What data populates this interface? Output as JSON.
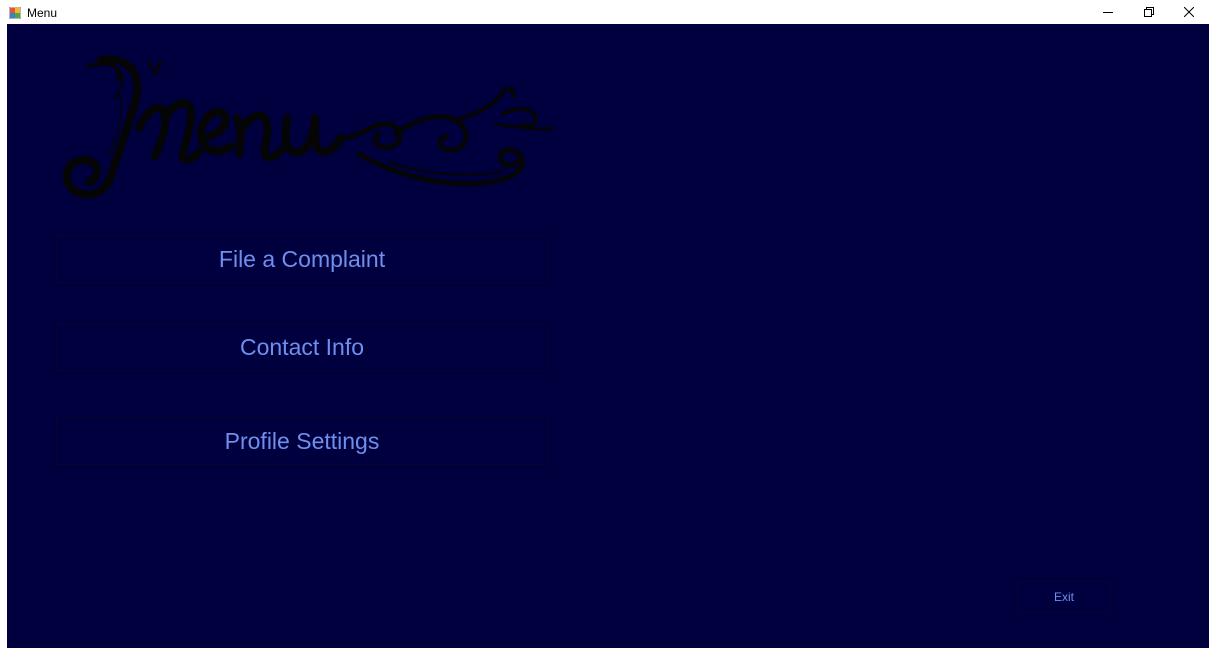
{
  "window": {
    "title": "Menu",
    "icon": "app-form-icon",
    "controls": {
      "minimize_icon": "minimize-icon",
      "restore_icon": "restore-icon",
      "close_icon": "close-icon"
    }
  },
  "logo": {
    "text": "Menu",
    "icon": "menu-logo-icon"
  },
  "menu": {
    "buttons": [
      {
        "label": "File a Complaint"
      },
      {
        "label": "Contact Info"
      },
      {
        "label": "Profile Settings"
      }
    ]
  },
  "footer": {
    "exit_label": "Exit"
  },
  "colors": {
    "background": "#00003f",
    "button_text": "#6f8fee",
    "logo": "#050505",
    "titlebar": "#ffffff"
  }
}
